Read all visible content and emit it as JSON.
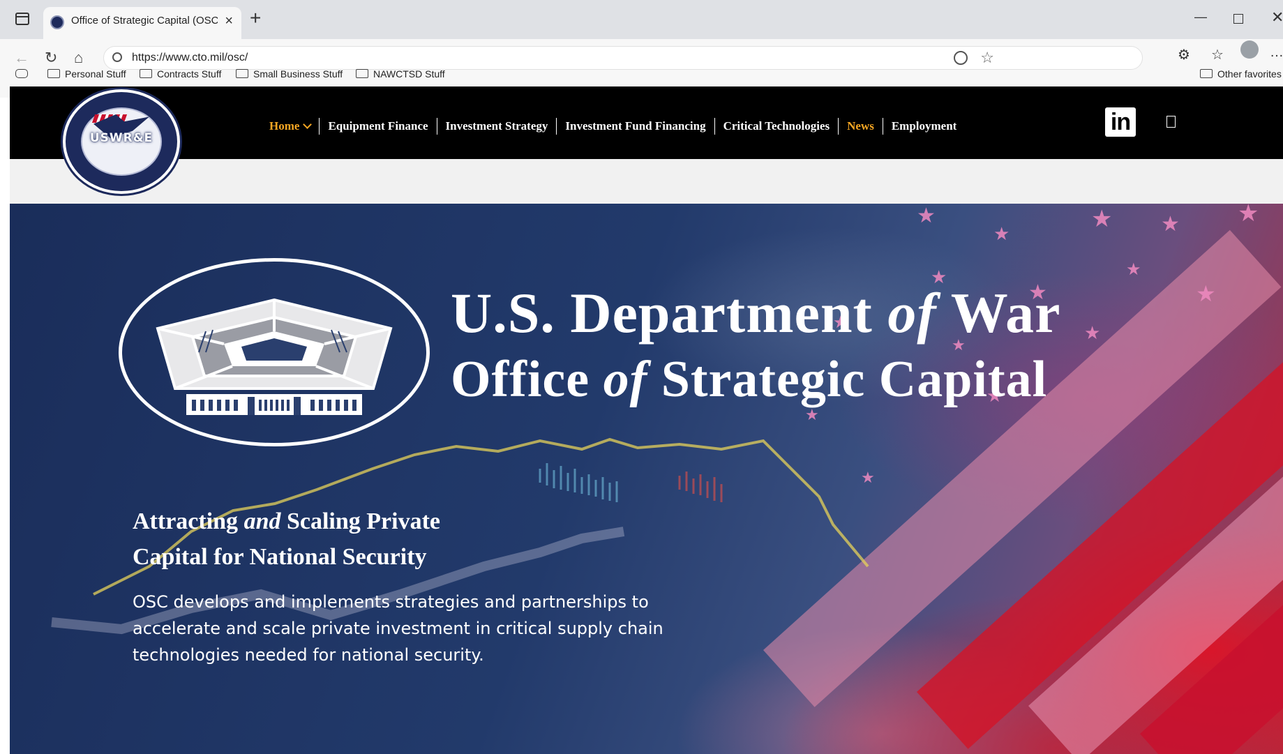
{
  "browser": {
    "tab_title": "Office of Strategic Capital (OSC) -",
    "url": "https://www.cto.mil/osc/",
    "bookmarks": [
      "Personal Stuff",
      "Contracts Stuff",
      "Small Business Stuff",
      "NAWCTSD Stuff"
    ],
    "other_favorites": "Other favorites"
  },
  "site": {
    "seal_text": "USWR&E",
    "nav": [
      {
        "label": "Home",
        "active": true
      },
      {
        "label": "Equipment Finance"
      },
      {
        "label": "Investment Strategy"
      },
      {
        "label": "Investment Fund Financing"
      },
      {
        "label": "Critical Technologies"
      },
      {
        "label": "News",
        "active": true
      },
      {
        "label": "Employment"
      }
    ],
    "linkedin_label": "in"
  },
  "hero": {
    "line1_a": "U.S. Department ",
    "line1_of": "of",
    "line1_b": " War",
    "line2_a": "Office ",
    "line2_of": "of",
    "line2_b": " Strategic Capital",
    "tagline_a": "Attracting ",
    "tagline_and": "and",
    "tagline_b": " Scaling Private",
    "tagline_c": "Capital for National Security",
    "description": "OSC develops and implements strategies and partnerships to accelerate and scale private investment in critical supply chain technologies needed for national security."
  },
  "colors": {
    "accent": "#f5a623",
    "header_bg": "#000000",
    "hero_navy": "#1a2d5a",
    "flag_red": "#c8102e"
  }
}
